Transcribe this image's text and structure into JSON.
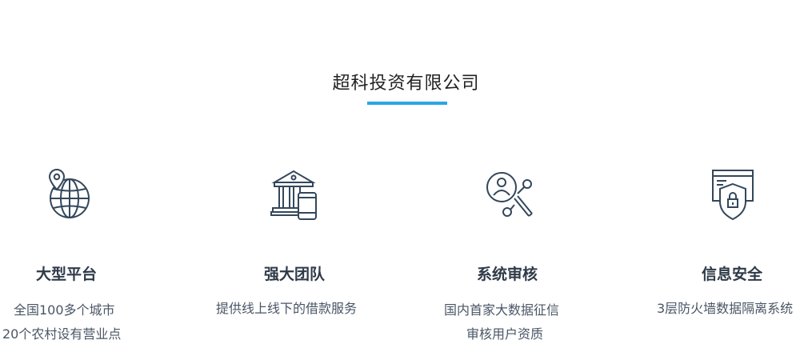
{
  "header": {
    "title": "超科投资有限公司"
  },
  "features": [
    {
      "icon": "globe-location-icon",
      "heading": "大型平台",
      "lines": [
        "全国100多个城市",
        "20个农村设有营业点"
      ]
    },
    {
      "icon": "bank-mobile-icon",
      "heading": "强大团队",
      "lines": [
        "提供线上线下的借款服务"
      ]
    },
    {
      "icon": "user-search-icon",
      "heading": "系统审核",
      "lines": [
        "国内首家大数据征信",
        "审核用户资质"
      ]
    },
    {
      "icon": "shield-lock-icon",
      "heading": "信息安全",
      "lines": [
        "3层防火墙数据隔离系统"
      ]
    }
  ],
  "colors": {
    "accent": "#2aa6e6",
    "icon_stroke": "#33475b",
    "heading": "#2f3a48",
    "text": "#4a5666"
  }
}
